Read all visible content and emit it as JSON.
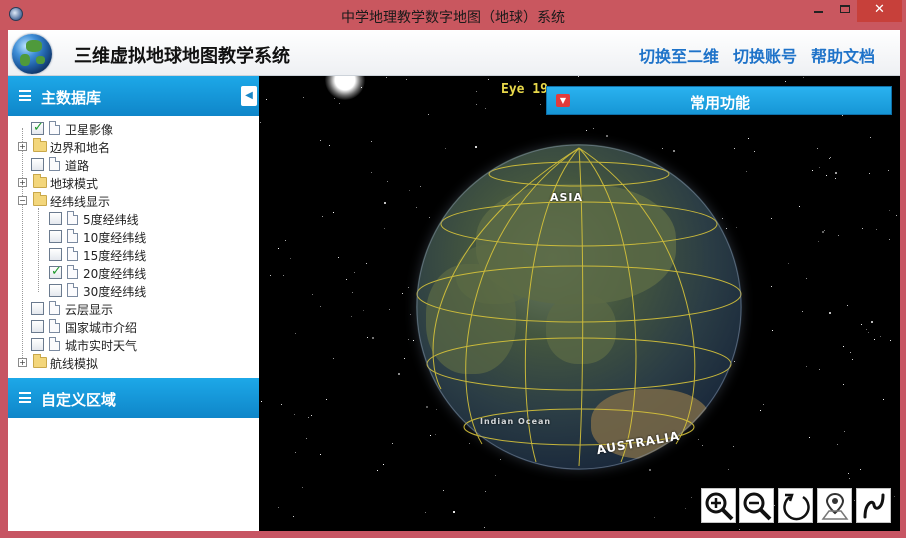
{
  "window": {
    "title": "中学地理教学数字地图（地球）系统",
    "controls": {
      "minimize": "–",
      "maximize": "□",
      "close": "✕"
    }
  },
  "header": {
    "app_title": "三维虚拟地球地图教学系统",
    "nav": [
      "切换至二维",
      "切换账号",
      "帮助文档"
    ]
  },
  "sidebar": {
    "main_panel": "主数据库",
    "custom_panel": "自定义区域",
    "collapse": "◀",
    "tree": [
      {
        "label": "卫星影像",
        "type": "layer",
        "checked": true
      },
      {
        "label": "边界和地名",
        "type": "folder",
        "expanded": false
      },
      {
        "label": "道路",
        "type": "layer",
        "checked": false
      },
      {
        "label": "地球模式",
        "type": "folder",
        "expanded": false
      },
      {
        "label": "经纬线显示",
        "type": "folder",
        "expanded": true
      },
      {
        "label": "5度经纬线",
        "type": "layer",
        "checked": false
      },
      {
        "label": "10度经纬线",
        "type": "layer",
        "checked": false
      },
      {
        "label": "15度经纬线",
        "type": "layer",
        "checked": false
      },
      {
        "label": "20度经纬线",
        "type": "layer",
        "checked": true
      },
      {
        "label": "30度经纬线",
        "type": "layer",
        "checked": false
      },
      {
        "label": "云层显示",
        "type": "layer",
        "checked": false
      },
      {
        "label": "国家城市介绍",
        "type": "layer",
        "checked": false
      },
      {
        "label": "城市实时天气",
        "type": "layer",
        "checked": false
      },
      {
        "label": "航线模拟",
        "type": "folder",
        "expanded": false
      }
    ]
  },
  "viewport": {
    "eye_readout": "Eye 19",
    "func_bar_label": "常用功能",
    "globe_labels": {
      "asia": "ASIA",
      "australia": "AUSTRALIA",
      "indian_ocean": "Indian Ocean"
    },
    "tools": [
      "zoom-in-icon",
      "zoom-out-icon",
      "rotate-icon",
      "map-pin-icon",
      "route-icon"
    ]
  },
  "colors": {
    "titlebar": "#c9575f",
    "accent_blue": "#1da8e8",
    "nav_link": "#1f73c9",
    "graticule": "#d8c43a",
    "check": "#1f9a2c"
  }
}
